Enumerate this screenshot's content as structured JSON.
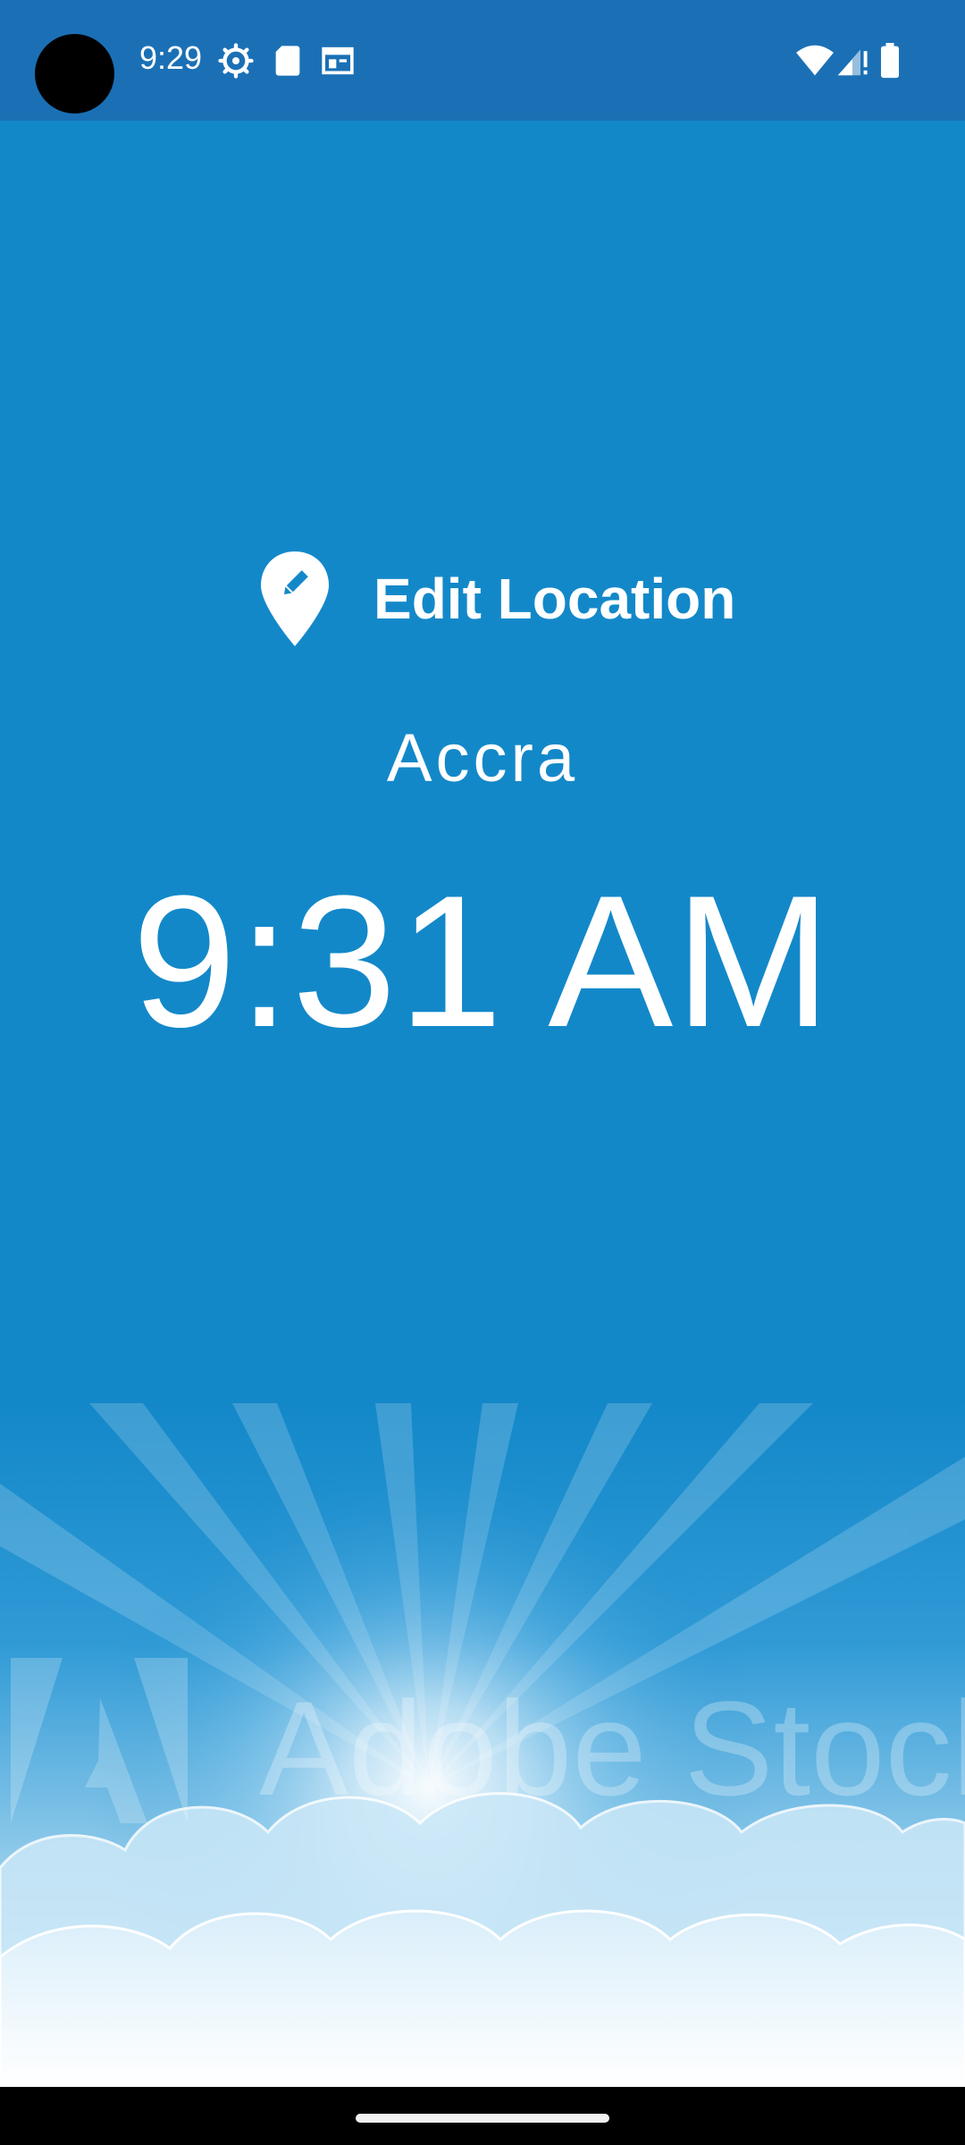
{
  "status_bar": {
    "time": "9:29",
    "icons": [
      "settings-gear-icon",
      "sd-card-icon",
      "calendar-icon",
      "wifi-icon",
      "signal-icon",
      "battery-icon"
    ],
    "background": "#1b70b5"
  },
  "location": {
    "edit_label": "Edit Location",
    "icon": "map-pin-edit-icon"
  },
  "city": "Accra",
  "clock": {
    "time": "9:31 AM"
  },
  "background_art": {
    "description_icon": "sky-clouds-sunburst",
    "watermark_text": "Adobe Stock"
  },
  "colors": {
    "sky_blue": "#1388c9",
    "status_bar": "#1b70b5",
    "text": "#ffffff",
    "nav_bar": "#000000"
  }
}
